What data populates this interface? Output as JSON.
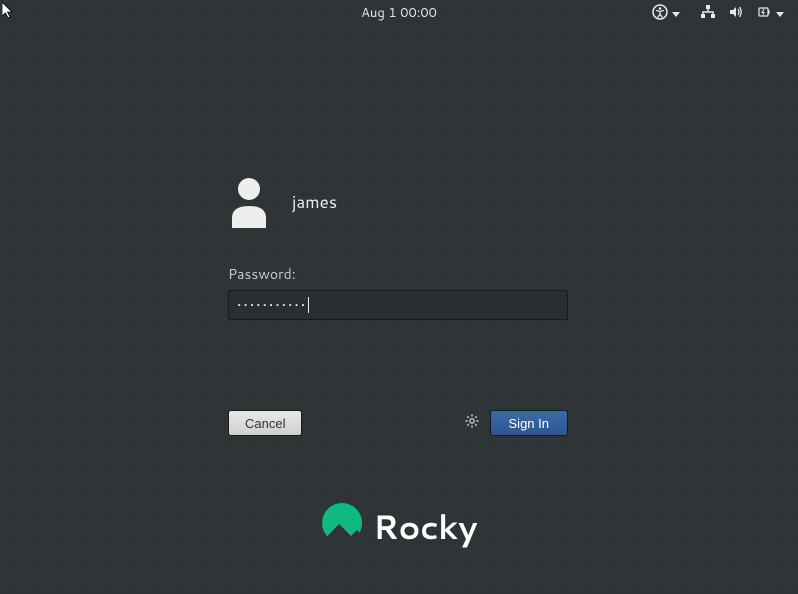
{
  "topbar": {
    "datetime": "Aug 1  00:00"
  },
  "login": {
    "username": "james",
    "password_label": "Password:",
    "password_value": "•••••••••••",
    "cancel_label": "Cancel",
    "signin_label": "Sign In"
  },
  "branding": {
    "name": "Rocky",
    "accent_color": "#10b981"
  }
}
